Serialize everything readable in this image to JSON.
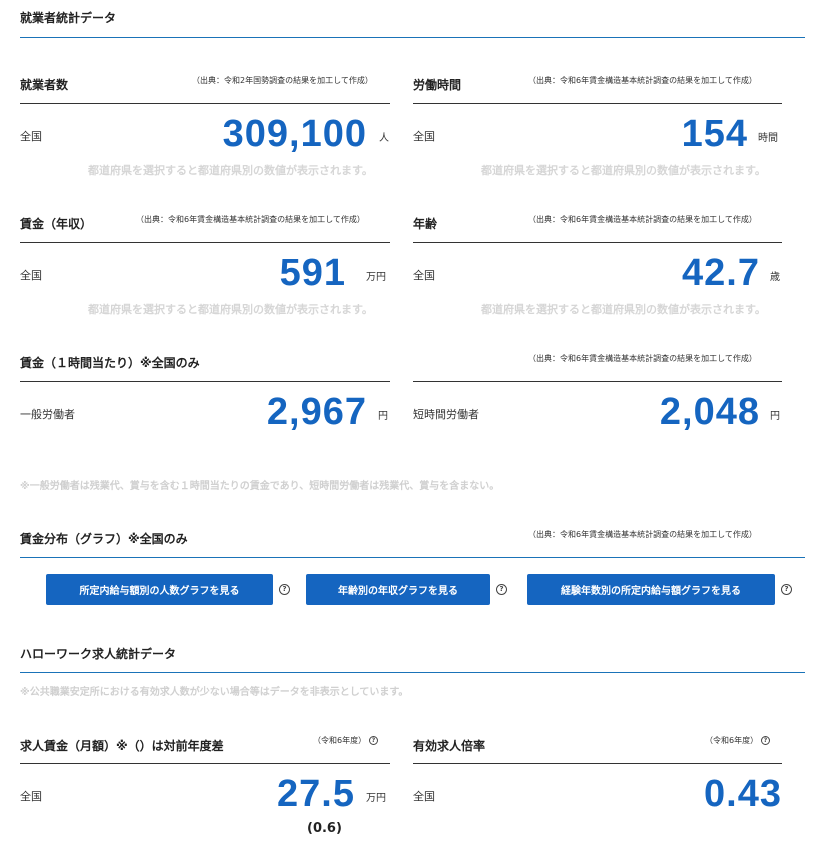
{
  "section_employment": {
    "title": "就業者統計データ",
    "workers": {
      "title": "就業者数",
      "source": "（出典：令和2年国勢調査の結果を加工して作成）",
      "area": "全国",
      "value": "309,100",
      "unit": "人",
      "hint": "都道府県を選択すると都道府県別の数値が表示されます。"
    },
    "hours": {
      "title": "労働時間",
      "source": "（出典：令和6年賃金構造基本統計調査の結果を加工して作成）",
      "area": "全国",
      "value": "154",
      "unit": "時間",
      "hint": "都道府県を選択すると都道府県別の数値が表示されます。"
    },
    "wage_annual": {
      "title": "賃金（年収）",
      "source": "（出典：令和6年賃金構造基本統計調査の結果を加工して作成）",
      "area": "全国",
      "value": "591",
      "unit": "万円",
      "hint": "都道府県を選択すると都道府県別の数値が表示されます。"
    },
    "age": {
      "title": "年齢",
      "source": "（出典：令和6年賃金構造基本統計調査の結果を加工して作成）",
      "area": "全国",
      "value": "42.7",
      "unit": "歳",
      "hint": "都道府県を選択すると都道府県別の数値が表示されます。"
    },
    "wage_hourly": {
      "title": "賃金（１時間当たり）※全国のみ",
      "source": "（出典：令和6年賃金構造基本統計調査の結果を加工して作成）",
      "general_label": "一般労働者",
      "general_value": "2,967",
      "general_unit": "円",
      "short_label": "短時間労働者",
      "short_value": "2,048",
      "short_unit": "円",
      "note": "※一般労働者は残業代、賞与を含む１時間当たりの賃金であり、短時間労働者は残業代、賞与を含まない。"
    },
    "wage_distribution": {
      "title": "賃金分布（グラフ）※全国のみ",
      "source": "（出典：令和6年賃金構造基本統計調査の結果を加工して作成）",
      "buttons": [
        "所定内給与額別の人数グラフを見る",
        "年齢別の年収グラフを見る",
        "経験年数別の所定内給与額グラフを見る"
      ],
      "help_glyph": "?"
    }
  },
  "section_hellowork": {
    "title": "ハローワーク求人統計データ",
    "note": "※公共職業安定所における有効求人数が少ない場合等はデータを非表示としています。",
    "job_wage": {
      "title": "求人賃金（月額）※（）は対前年度差",
      "year": "（令和6年度）",
      "area": "全国",
      "value": "27.5",
      "unit": "万円",
      "diff": "(0.6)"
    },
    "job_ratio": {
      "title": "有効求人倍率",
      "year": "（令和6年度）",
      "area": "全国",
      "value": "0.43"
    }
  }
}
